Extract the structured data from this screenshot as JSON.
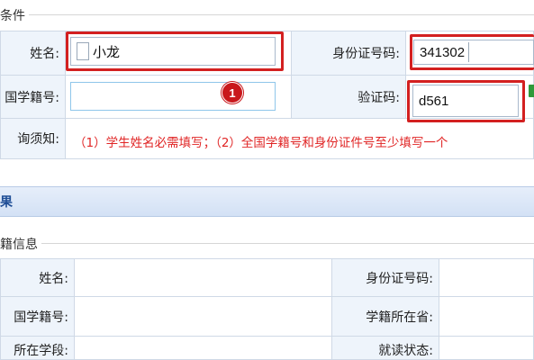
{
  "section_conditions": {
    "legend": "条件"
  },
  "form": {
    "name_label": "姓名:",
    "name_value": "小龙",
    "id_label": "身份证号码:",
    "id_value": "341302",
    "student_no_label": "国学籍号:",
    "student_no_value": "",
    "captcha_label": "验证码:",
    "captcha_value": "d561",
    "notice_label": "询须知:",
    "notice_text": "（1）学生姓名必需填写；（2）全国学籍号和身份证件号至少填写一个"
  },
  "annotation": {
    "marker": "1"
  },
  "result": {
    "title": "果"
  },
  "section_info": {
    "legend": "籍信息"
  },
  "info": {
    "name_label": "姓名:",
    "id_label": "身份证号码:",
    "student_no_label": "国学籍号:",
    "province_label": "学籍所在省:",
    "stage_label": "所在学段:",
    "status_label": "就读状态:"
  },
  "colors": {
    "accent_red": "#d32020",
    "label_bg": "#eef4fb",
    "bar_text": "#1f4e96"
  }
}
